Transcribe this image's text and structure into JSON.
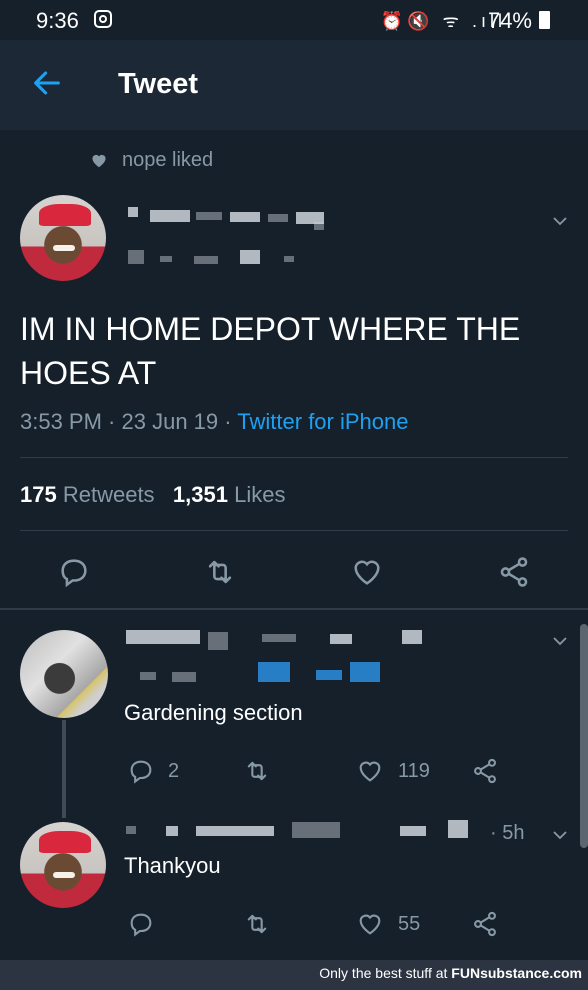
{
  "status_bar": {
    "time": "9:36",
    "battery": "74%"
  },
  "app_bar": {
    "title": "Tweet"
  },
  "liked_by": "nope liked",
  "tweet": {
    "text": "IM IN HOME DEPOT WHERE THE HOES AT",
    "time": "3:53 PM",
    "date": "23 Jun 19",
    "source": "Twitter for iPhone",
    "retweets_count": "175",
    "retweets_label": "Retweets",
    "likes_count": "1,351",
    "likes_label": "Likes"
  },
  "replies": [
    {
      "text": "Gardening section",
      "reply_count": "2",
      "like_count": "119"
    },
    {
      "text": "Thankyou",
      "time": "5h",
      "like_count": "55"
    }
  ],
  "footer": {
    "text": "Only the best stuff at",
    "brand": "FUNsubstance.com"
  },
  "colors": {
    "background": "#15202b",
    "app_bar": "#1c2836",
    "accent": "#1da1f2",
    "muted": "#8899a6"
  }
}
